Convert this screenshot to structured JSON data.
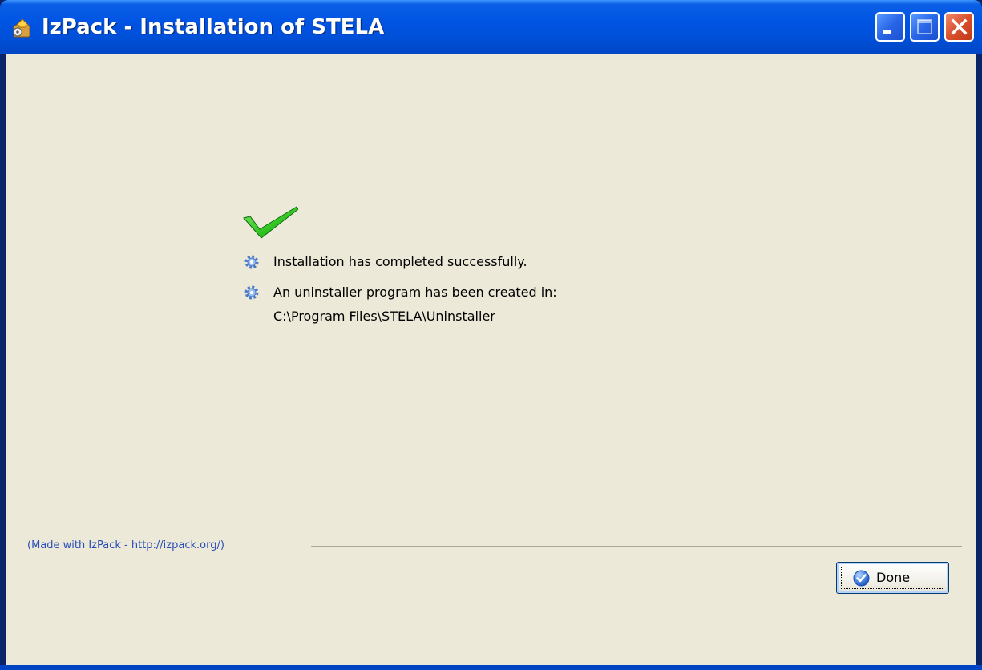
{
  "window": {
    "title": "IzPack - Installation of STELA",
    "icon": "izpack-app-icon",
    "controls": [
      "minimize-icon",
      "maximize-icon",
      "close-icon"
    ]
  },
  "status": {
    "icon": "checkmark-icon",
    "messages": [
      {
        "icon": "gear-icon",
        "text": "Installation has completed successfully."
      },
      {
        "icon": "gear-icon",
        "text": "An uninstaller program has been created in:",
        "detail": "C:\\Program Files\\STELA\\Uninstaller"
      }
    ]
  },
  "footer": {
    "credit": "(Made with IzPack - http://izpack.org/)"
  },
  "buttons": {
    "done_label": "Done",
    "done_icon": "done-check-icon"
  },
  "colors": {
    "titlebar": "#0054e3",
    "client_background": "#ece9d8",
    "credit_text": "#2a4fb8",
    "checkmark": "#2ec21e",
    "close_button": "#d8502c"
  }
}
